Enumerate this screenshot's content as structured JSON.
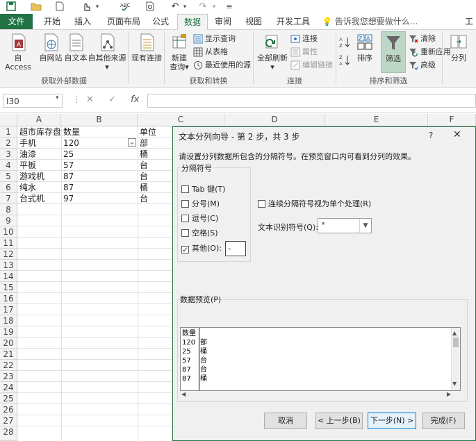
{
  "tabs": [
    "文件",
    "开始",
    "插入",
    "页面布局",
    "公式",
    "数据",
    "审阅",
    "视图",
    "开发工具"
  ],
  "active_tab": "数据",
  "tell_me": "告诉我您想要做什么...",
  "title_fragment": "工",
  "ribbon": {
    "external": {
      "access": "自 Access",
      "web": "自网站",
      "text": "自文本",
      "other": "自其他来源",
      "existing": "现有连接",
      "group": "获取外部数据"
    },
    "transform": {
      "new_query": "新建",
      "new_query2": "查询",
      "show_queries": "显示查询",
      "from_table": "从表格",
      "recent": "最近使用的源",
      "group": "获取和转换"
    },
    "connections": {
      "refresh": "全部刷新",
      "connections": "连接",
      "properties": "属性",
      "edit_links": "编辑链接",
      "group": "连接"
    },
    "sort_filter": {
      "sort": "排序",
      "filter": "筛选",
      "clear": "清除",
      "reapply": "重新应用",
      "advanced": "高级",
      "group": "排序和筛选"
    },
    "split": "分列"
  },
  "formula_bar": {
    "name_box": "I30",
    "fx": "fx",
    "cancel": "✕",
    "enter": "✓"
  },
  "columns": [
    "A",
    "B",
    "C",
    "D",
    "E",
    "F"
  ],
  "rows": [
    "1",
    "2",
    "3",
    "4",
    "5",
    "6",
    "7",
    "8",
    "9",
    "10",
    "11",
    "12",
    "13",
    "14",
    "15",
    "16",
    "17",
    "18",
    "19",
    "20",
    "21",
    "22",
    "23",
    "24",
    "25",
    "26",
    "27",
    "28"
  ],
  "cells": {
    "A1": "超市库存盘点",
    "B1": "数量",
    "C1": "单位",
    "A2": "手机",
    "B2": "120",
    "C2": "部",
    "A3": "油漆",
    "B3": "25",
    "C3": "桶",
    "A4": "平板",
    "B4": "57",
    "C4": "台",
    "A5": "游戏机",
    "B5": "87",
    "C5": "台",
    "A6": "纯水",
    "B6": "87",
    "C6": "桶",
    "A7": "台式机",
    "B7": "97",
    "C7": "台"
  },
  "dialog": {
    "title": "文本分列向导 - 第 2 步，共 3 步",
    "help": "?",
    "close": "✕",
    "instruction": "请设置分列数据所包含的分隔符号。在预览窗口内可看到分列的效果。",
    "delimiters_label": "分隔符号",
    "options": [
      {
        "label": "Tab 键(T)",
        "checked": false
      },
      {
        "label": "分号(M)",
        "checked": false
      },
      {
        "label": "逗号(C)",
        "checked": false
      },
      {
        "label": "空格(S)",
        "checked": false
      },
      {
        "label": "其他(O):",
        "checked": true
      }
    ],
    "other_value": "-",
    "consecutive": "连续分隔符号视为单个处理(R)",
    "qualifier_label": "文本识别符号(Q):",
    "qualifier_value": "\"",
    "preview_label": "数据预览(P)",
    "preview_col1": [
      "数量",
      "120",
      "25",
      "57",
      "87",
      "87"
    ],
    "preview_col2": [
      "",
      "部",
      "桶",
      "台",
      "台",
      "桶"
    ],
    "buttons": {
      "cancel": "取消",
      "back": "< 上一步(B)",
      "next": "下一步(N) >",
      "finish": "完成(F)"
    }
  },
  "colors": {
    "excel_green": "#217346",
    "dialog_border": "#217346",
    "primary_btn": "#0078d7"
  }
}
